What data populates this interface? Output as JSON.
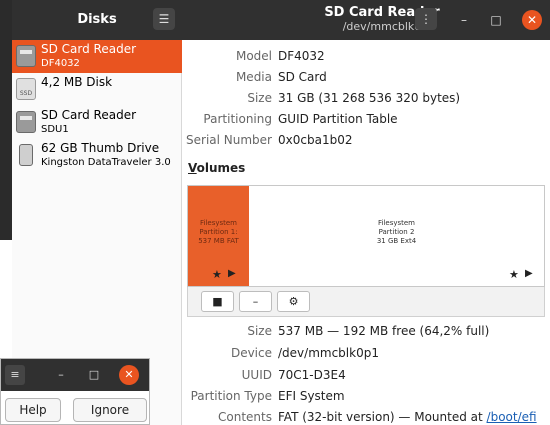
{
  "sidebar": {
    "title": "Disks",
    "menu_icon": "hamburger-icon",
    "disks": [
      {
        "name": "SD Card Reader",
        "sub": "DF4032",
        "icon": "sd-card-icon",
        "selected": true
      },
      {
        "name": "4,2 MB Disk",
        "sub": "",
        "icon": "ssd-icon",
        "icon_text": "SSD",
        "selected": false
      },
      {
        "name": "SD Card Reader",
        "sub": "SDU1",
        "icon": "sd-card-icon",
        "selected": false
      },
      {
        "name": "62 GB Thumb Drive",
        "sub": "Kingston DataTraveler 3.0",
        "icon": "usb-drive-icon",
        "selected": false
      }
    ]
  },
  "header": {
    "title": "SD Card Reader",
    "subtitle": "/dev/mmcblk0",
    "menu_icon": "kebab-icon",
    "minimize": "–",
    "maximize": "□",
    "close": "✕",
    "accent": "#e95420"
  },
  "details": {
    "model_label": "Model",
    "model": "DF4032",
    "media_label": "Media",
    "media": "SD Card",
    "size_label": "Size",
    "size": "31 GB (31 268 536 320 bytes)",
    "partitioning_label": "Partitioning",
    "partitioning": "GUID Partition Table",
    "serial_label": "Serial Number",
    "serial": "0x0cba1b02"
  },
  "volumes": {
    "title_prefix": "V",
    "title_rest": "olumes",
    "partition1": {
      "line1": "Filesystem",
      "line2": "Partition 1:",
      "line3": "537 MB FAT",
      "color": "#e8602a"
    },
    "partition2": {
      "line1": "Filesystem",
      "line2": "Partition 2",
      "line3": "31 GB Ext4"
    },
    "star": "★",
    "play": "▶",
    "toolbar": {
      "stop": "■",
      "minus": "–",
      "settings": "⚙"
    }
  },
  "partition_details": {
    "size_label": "Size",
    "size": "537 MB — 192 MB free (64,2% full)",
    "device_label": "Device",
    "device": "/dev/mmcblk0p1",
    "uuid_label": "UUID",
    "uuid": "70C1-D3E4",
    "type_label": "Partition Type",
    "type": "EFI System",
    "contents_label": "Contents",
    "contents": "FAT (32-bit version) — Mounted at ",
    "mount_link": "/boot/efi"
  },
  "dialog": {
    "menu": "≡",
    "minimize": "–",
    "maximize": "□",
    "close": "✕",
    "help": "Help",
    "ignore": "Ignore"
  }
}
